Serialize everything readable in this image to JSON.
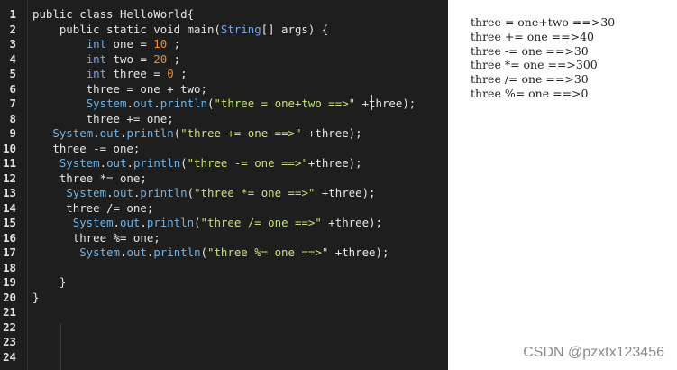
{
  "editor": {
    "lines": [
      {
        "n": "1",
        "tokens": [
          {
            "t": "public class HelloWorld{",
            "c": "t-txt"
          }
        ]
      },
      {
        "n": "2",
        "tokens": [
          {
            "t": "    public static void ",
            "c": "t-txt"
          },
          {
            "t": "main",
            "c": "t-txt"
          },
          {
            "t": "(",
            "c": "t-txt"
          },
          {
            "t": "String",
            "c": "t-type"
          },
          {
            "t": "[] args) {",
            "c": "t-txt"
          }
        ]
      },
      {
        "n": "3",
        "tokens": [
          {
            "t": "        ",
            "c": "t-txt"
          },
          {
            "t": "int",
            "c": "t-type"
          },
          {
            "t": " one = ",
            "c": "t-txt"
          },
          {
            "t": "10",
            "c": "t-num"
          },
          {
            "t": " ;",
            "c": "t-txt"
          }
        ]
      },
      {
        "n": "4",
        "tokens": [
          {
            "t": "        ",
            "c": "t-txt"
          },
          {
            "t": "int",
            "c": "t-type"
          },
          {
            "t": " two = ",
            "c": "t-txt"
          },
          {
            "t": "20",
            "c": "t-num"
          },
          {
            "t": " ;",
            "c": "t-txt"
          }
        ]
      },
      {
        "n": "5",
        "tokens": [
          {
            "t": "        ",
            "c": "t-txt"
          },
          {
            "t": "int",
            "c": "t-type"
          },
          {
            "t": " three = ",
            "c": "t-txt"
          },
          {
            "t": "0",
            "c": "t-num"
          },
          {
            "t": " ;",
            "c": "t-txt"
          }
        ]
      },
      {
        "n": "6",
        "tokens": [
          {
            "t": "        three = one + two;",
            "c": "t-txt"
          }
        ]
      },
      {
        "n": "7",
        "tokens": [
          {
            "t": "        ",
            "c": "t-txt"
          },
          {
            "t": "System",
            "c": "t-obj"
          },
          {
            "t": ".",
            "c": "t-txt"
          },
          {
            "t": "out",
            "c": "t-obj"
          },
          {
            "t": ".",
            "c": "t-txt"
          },
          {
            "t": "println",
            "c": "t-obj"
          },
          {
            "t": "(",
            "c": "t-txt"
          },
          {
            "t": "\"three = one+two ==>\"",
            "c": "t-str"
          },
          {
            "t": " +three);",
            "c": "t-txt"
          }
        ]
      },
      {
        "n": "8",
        "tokens": [
          {
            "t": "        three += one;",
            "c": "t-txt"
          }
        ]
      },
      {
        "n": "9",
        "tokens": [
          {
            "t": "   ",
            "c": "t-txt"
          },
          {
            "t": "System",
            "c": "t-obj"
          },
          {
            "t": ".",
            "c": "t-txt"
          },
          {
            "t": "out",
            "c": "t-obj"
          },
          {
            "t": ".",
            "c": "t-txt"
          },
          {
            "t": "println",
            "c": "t-obj"
          },
          {
            "t": "(",
            "c": "t-txt"
          },
          {
            "t": "\"three += one ==>\"",
            "c": "t-str"
          },
          {
            "t": " +three);",
            "c": "t-txt"
          }
        ]
      },
      {
        "n": "10",
        "tokens": [
          {
            "t": "   three -= one;",
            "c": "t-txt"
          }
        ]
      },
      {
        "n": "11",
        "tokens": [
          {
            "t": "    ",
            "c": "t-txt"
          },
          {
            "t": "System",
            "c": "t-obj"
          },
          {
            "t": ".",
            "c": "t-txt"
          },
          {
            "t": "out",
            "c": "t-obj"
          },
          {
            "t": ".",
            "c": "t-txt"
          },
          {
            "t": "println",
            "c": "t-obj"
          },
          {
            "t": "(",
            "c": "t-txt"
          },
          {
            "t": "\"three -= one ==>\"",
            "c": "t-str"
          },
          {
            "t": "+three);",
            "c": "t-txt"
          }
        ]
      },
      {
        "n": "12",
        "tokens": [
          {
            "t": "    three *= one;",
            "c": "t-txt"
          }
        ]
      },
      {
        "n": "13",
        "tokens": [
          {
            "t": "     ",
            "c": "t-txt"
          },
          {
            "t": "System",
            "c": "t-obj"
          },
          {
            "t": ".",
            "c": "t-txt"
          },
          {
            "t": "out",
            "c": "t-obj"
          },
          {
            "t": ".",
            "c": "t-txt"
          },
          {
            "t": "println",
            "c": "t-obj"
          },
          {
            "t": "(",
            "c": "t-txt"
          },
          {
            "t": "\"three *= one ==>\"",
            "c": "t-str"
          },
          {
            "t": " +three);",
            "c": "t-txt"
          }
        ]
      },
      {
        "n": "14",
        "tokens": [
          {
            "t": "     three /= one;",
            "c": "t-txt"
          }
        ]
      },
      {
        "n": "15",
        "tokens": [
          {
            "t": "      ",
            "c": "t-txt"
          },
          {
            "t": "System",
            "c": "t-obj"
          },
          {
            "t": ".",
            "c": "t-txt"
          },
          {
            "t": "out",
            "c": "t-obj"
          },
          {
            "t": ".",
            "c": "t-txt"
          },
          {
            "t": "println",
            "c": "t-obj"
          },
          {
            "t": "(",
            "c": "t-txt"
          },
          {
            "t": "\"three /= one ==>\"",
            "c": "t-str"
          },
          {
            "t": " +three);",
            "c": "t-txt"
          }
        ]
      },
      {
        "n": "16",
        "tokens": [
          {
            "t": "      three %= one;",
            "c": "t-txt"
          }
        ]
      },
      {
        "n": "17",
        "tokens": [
          {
            "t": "       ",
            "c": "t-txt"
          },
          {
            "t": "System",
            "c": "t-obj"
          },
          {
            "t": ".",
            "c": "t-txt"
          },
          {
            "t": "out",
            "c": "t-obj"
          },
          {
            "t": ".",
            "c": "t-txt"
          },
          {
            "t": "println",
            "c": "t-obj"
          },
          {
            "t": "(",
            "c": "t-txt"
          },
          {
            "t": "\"three %= one ==>\"",
            "c": "t-str"
          },
          {
            "t": " +three);",
            "c": "t-txt"
          }
        ]
      },
      {
        "n": "18",
        "tokens": []
      },
      {
        "n": "19",
        "tokens": [
          {
            "t": "    }",
            "c": "t-txt"
          }
        ]
      },
      {
        "n": "20",
        "tokens": [
          {
            "t": "}",
            "c": "t-txt"
          }
        ]
      },
      {
        "n": "21",
        "tokens": []
      },
      {
        "n": "22",
        "tokens": []
      },
      {
        "n": "23",
        "tokens": []
      },
      {
        "n": "24",
        "tokens": []
      }
    ]
  },
  "console": {
    "output": [
      "three = one+two ==>30",
      "three += one ==>40",
      "three -= one ==>30",
      "three *= one ==>300",
      "three /= one ==>30",
      "three %= one ==>0"
    ]
  },
  "watermark": "CSDN @pzxtx123456",
  "colors": {
    "editor_bg": "#1e1e1e",
    "keyword_type": "#7aa7e0",
    "number": "#ef8a2e",
    "string": "#c7e07a",
    "object": "#6fb3e6"
  }
}
